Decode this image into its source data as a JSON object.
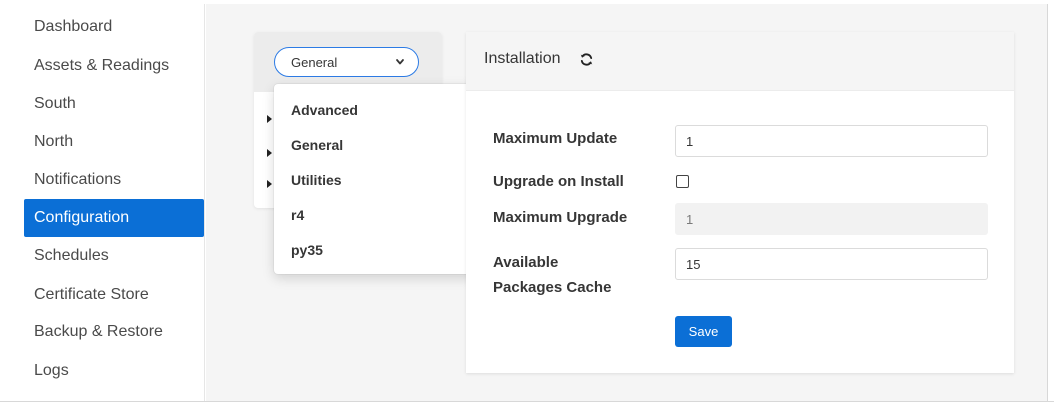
{
  "sidebar": {
    "items": [
      {
        "label": "Dashboard"
      },
      {
        "label": "Assets & Readings"
      },
      {
        "label": "South"
      },
      {
        "label": "North"
      },
      {
        "label": "Notifications"
      },
      {
        "label": "Configuration",
        "active": true
      },
      {
        "label": "Schedules"
      },
      {
        "label": "Certificate Store"
      },
      {
        "label": "Backup & Restore"
      },
      {
        "label": "Logs"
      }
    ]
  },
  "category_select": {
    "selected": "General",
    "options": [
      "Advanced",
      "General",
      "Utilities",
      "r4",
      "py35"
    ]
  },
  "card": {
    "title": "Installation",
    "refresh_icon": "refresh-icon",
    "fields": [
      {
        "label": "Maximum Update",
        "value": "1"
      },
      {
        "label": "Upgrade on Install",
        "checked": false
      },
      {
        "label": "Maximum Upgrade",
        "value": "1",
        "disabled": true
      },
      {
        "label_line1": "Available",
        "label_line2": "Packages Cache",
        "value": "15"
      }
    ],
    "save_label": "Save"
  },
  "colors": {
    "accent": "#0b6fd6",
    "select_border": "#2c7be5",
    "background": "#f5f5f5"
  }
}
